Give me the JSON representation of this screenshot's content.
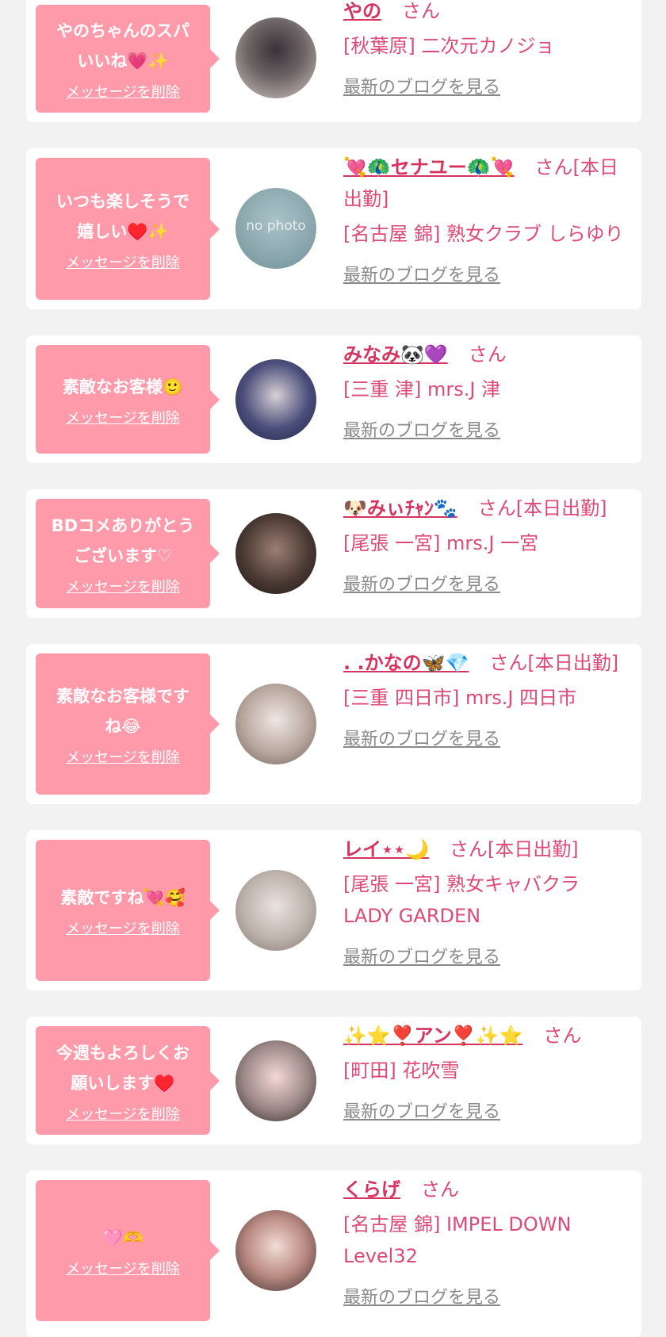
{
  "colors": {
    "background": "#f2f2f3",
    "card": "#ffffff",
    "bubble": "#ff9aab",
    "name": "#d6335f",
    "shop_text": "#dd4a77",
    "blog_link": "#8a8a8a"
  },
  "items": [
    {
      "message": "やのちゃんのスパ\nいいね💗✨",
      "delete_label": "メッセージを削除",
      "avatar_label": "",
      "name": "やの",
      "suffix": "さん",
      "shop": "[秋葉原] 二次元カノジョ",
      "blog_label": "最新のブログを見る"
    },
    {
      "message": "いつも楽しそうで\n嬉しい♥️✨",
      "delete_label": "メッセージを削除",
      "avatar_label": "no photo",
      "name": "💘🦚セナユー🦚💘",
      "suffix": "さん[本日出勤]",
      "shop": "[名古屋 錦] 熟女クラブ しらゆり",
      "blog_label": "最新のブログを見る"
    },
    {
      "message": "素敵なお客様🙂",
      "delete_label": "メッセージを削除",
      "avatar_label": "",
      "name": "みなみ🐼💜",
      "suffix": "さん",
      "shop": "[三重 津] mrs.J 津",
      "blog_label": "最新のブログを見る"
    },
    {
      "message": "BDコメありがとう\nございます♡",
      "delete_label": "メッセージを削除",
      "avatar_label": "",
      "name": "🐶みぃﾁｬﾝ🐾",
      "suffix": "さん[本日出勤]",
      "shop": "[尾張 一宮] mrs.J 一宮",
      "blog_label": "最新のブログを見る"
    },
    {
      "message": "素敵なお客様です\nね😂",
      "delete_label": "メッセージを削除",
      "avatar_label": "",
      "name": ". .かなの🦋💎",
      "suffix": "さん[本日出勤]",
      "shop": "[三重 四日市] mrs.J 四日市",
      "blog_label": "最新のブログを見る"
    },
    {
      "message": "素敵ですね💘🥰",
      "delete_label": "メッセージを削除",
      "avatar_label": "",
      "name": "レイ⋆⋆🌙",
      "suffix": "さん[本日出勤]",
      "shop": "[尾張 一宮] 熟女キャバクラ LADY GARDEN",
      "blog_label": "最新のブログを見る"
    },
    {
      "message": "今週もよろしくお\n願いします♥️",
      "delete_label": "メッセージを削除",
      "avatar_label": "",
      "name": "✨⭐❣️アン❣️✨⭐",
      "suffix": "さん",
      "shop": "[町田] 花吹雪",
      "blog_label": "最新のブログを見る"
    },
    {
      "message": "🩷🫶",
      "delete_label": "メッセージを削除",
      "avatar_label": "",
      "name": "くらげ",
      "suffix": "さん",
      "shop": "[名古屋 錦] IMPEL DOWN Level32",
      "blog_label": "最新のブログを見る"
    }
  ]
}
